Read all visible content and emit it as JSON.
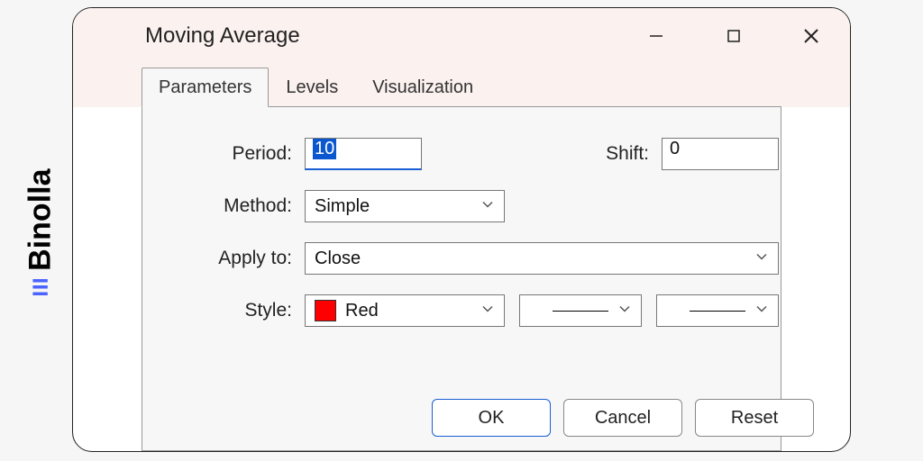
{
  "brand": {
    "name": "Binolla"
  },
  "dialog": {
    "title": "Moving Average"
  },
  "tabs": [
    {
      "label": "Parameters",
      "active": true
    },
    {
      "label": "Levels",
      "active": false
    },
    {
      "label": "Visualization",
      "active": false
    }
  ],
  "form": {
    "period_label": "Period:",
    "period_value": "10",
    "shift_label": "Shift:",
    "shift_value": "0",
    "method_label": "Method:",
    "method_value": "Simple",
    "apply_to_label": "Apply to:",
    "apply_to_value": "Close",
    "style_label": "Style:",
    "style_color_name": "Red",
    "style_color_hex": "#ff0000"
  },
  "buttons": {
    "ok": "OK",
    "cancel": "Cancel",
    "reset": "Reset"
  }
}
